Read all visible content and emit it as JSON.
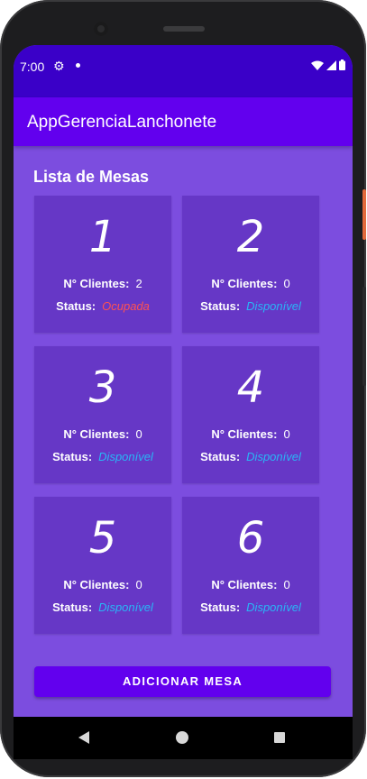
{
  "status_bar": {
    "time": "7:00",
    "icons": [
      "settings-icon",
      "notification-dot-icon",
      "wifi-icon",
      "signal-icon",
      "battery-icon"
    ]
  },
  "app_bar": {
    "title": "AppGerenciaLanchonete"
  },
  "list": {
    "title": "Lista de Mesas",
    "clients_label": "N° Clientes:",
    "status_label": "Status:",
    "tables": [
      {
        "number": "1",
        "clients": "2",
        "status": "Ocupada"
      },
      {
        "number": "2",
        "clients": "0",
        "status": "Disponível"
      },
      {
        "number": "3",
        "clients": "0",
        "status": "Disponível"
      },
      {
        "number": "4",
        "clients": "0",
        "status": "Disponível"
      },
      {
        "number": "5",
        "clients": "0",
        "status": "Disponível"
      },
      {
        "number": "6",
        "clients": "0",
        "status": "Disponível"
      }
    ]
  },
  "add_button": {
    "label": "ADICIONAR MESA"
  },
  "colors": {
    "primary": "#6200ee",
    "status_bar": "#3a00c8",
    "background": "#7c4ddf",
    "card": "#6637c6",
    "occupied": "#ff5252",
    "available": "#29b6f6"
  },
  "nav_bar": {
    "icons": [
      "back-icon",
      "home-icon",
      "recents-icon"
    ]
  }
}
